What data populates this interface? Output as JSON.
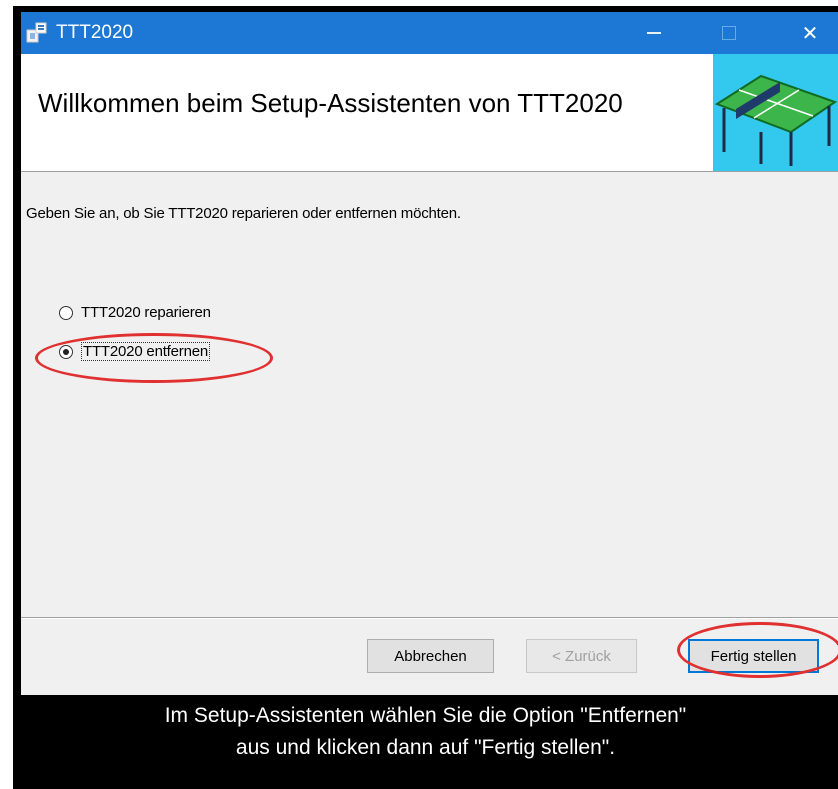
{
  "window": {
    "title": "TTT2020",
    "heading": "Willkommen beim Setup-Assistenten von TTT2020",
    "instruction": "Geben Sie an, ob Sie TTT2020 reparieren oder entfernen möchten."
  },
  "options": [
    {
      "label": "TTT2020 reparieren",
      "selected": false
    },
    {
      "label": "TTT2020 entfernen",
      "selected": true
    }
  ],
  "buttons": {
    "cancel": "Abbrechen",
    "back": "< Zurück",
    "finish": "Fertig stellen"
  },
  "titlebar_icons": [
    "installer-icon",
    "minimize-icon",
    "maximize-icon",
    "close-icon"
  ],
  "caption": {
    "line1": "Im Setup-Assistenten wählen Sie die Option \"Entfernen\"",
    "line2": "aus und klicken dann auf \"Fertig stellen\"."
  },
  "colors": {
    "titlebar": "#1c78d4",
    "banner": "#33c8ee",
    "highlight": "#e03030",
    "focus": "#0078d7"
  }
}
